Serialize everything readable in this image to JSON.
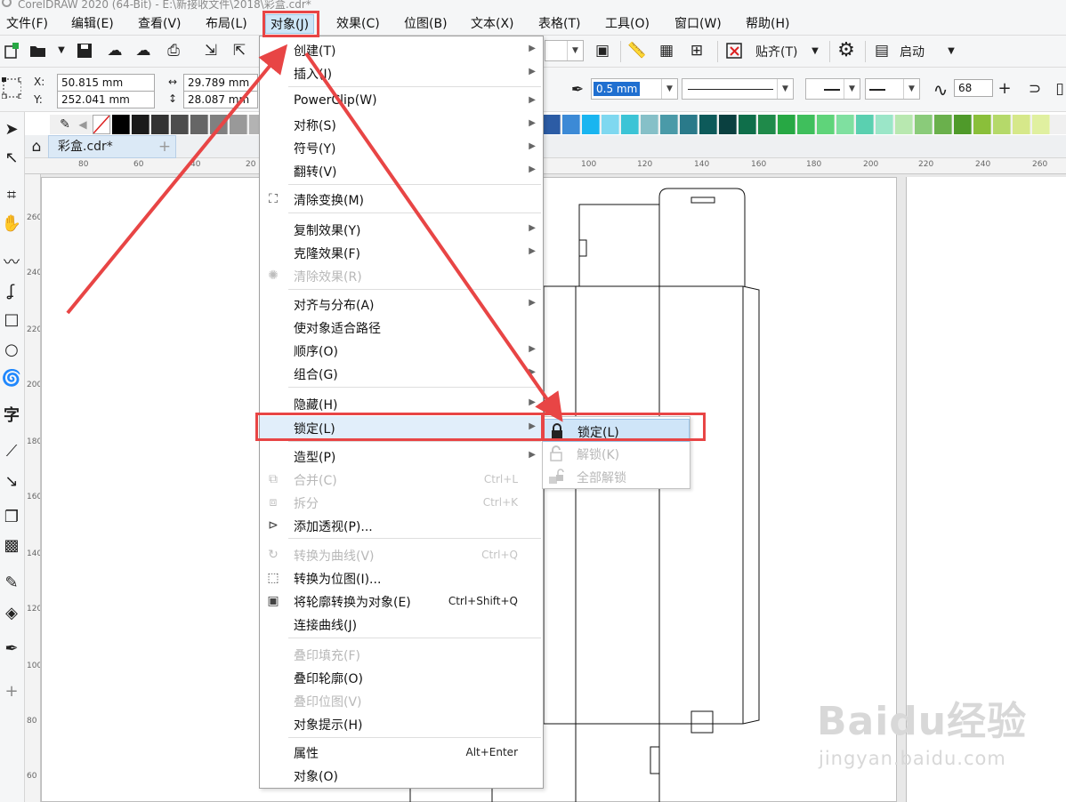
{
  "window": {
    "title": "CorelDRAW 2020 (64-Bit) - E:\\新接收文件\\2018\\彩盒.cdr*"
  },
  "menubar": {
    "items": [
      "文件(F)",
      "编辑(E)",
      "查看(V)",
      "布局(L)",
      "对象(J)",
      "效果(C)",
      "位图(B)",
      "文本(X)",
      "表格(T)",
      "工具(O)",
      "窗口(W)",
      "帮助(H)"
    ]
  },
  "toolbar": {
    "snap_label": "贴齐(T)",
    "launch_label": "启动"
  },
  "property_bar": {
    "x_label": "X:",
    "x_value": "50.815 mm",
    "y_label": "Y:",
    "y_value": "252.041 mm",
    "w_value": "29.789 mm",
    "h_value": "28.087 mm",
    "outline_width": "0.5 mm",
    "smoothing_value": "68"
  },
  "document": {
    "tab_label": "彩盒.cdr*"
  },
  "rulers": {
    "horizontal_ticks": [
      "80",
      "60",
      "40",
      "20",
      "100",
      "120",
      "140",
      "160",
      "180",
      "200",
      "220",
      "240",
      "260"
    ],
    "vertical_ticks": [
      "260",
      "240",
      "220",
      "200",
      "180",
      "160",
      "140",
      "120",
      "100",
      "80",
      "60"
    ]
  },
  "object_menu": {
    "items": [
      {
        "label": "创建(T)",
        "submenu": true,
        "disabled": false
      },
      {
        "label": "插入(I)",
        "submenu": true,
        "disabled": false
      },
      {
        "label": "PowerClip(W)",
        "submenu": true,
        "disabled": false
      },
      {
        "label": "对称(S)",
        "submenu": true,
        "disabled": false
      },
      {
        "label": "符号(Y)",
        "submenu": true,
        "disabled": false
      },
      {
        "label": "翻转(V)",
        "submenu": true,
        "disabled": false
      },
      {
        "label": "清除变换(M)",
        "submenu": false,
        "disabled": false
      },
      {
        "label": "复制效果(Y)",
        "submenu": true,
        "disabled": false
      },
      {
        "label": "克隆效果(F)",
        "submenu": true,
        "disabled": false
      },
      {
        "label": "清除效果(R)",
        "submenu": false,
        "disabled": true
      },
      {
        "label": "对齐与分布(A)",
        "submenu": true,
        "disabled": false
      },
      {
        "label": "使对象适合路径",
        "submenu": false,
        "disabled": false
      },
      {
        "label": "顺序(O)",
        "submenu": true,
        "disabled": false
      },
      {
        "label": "组合(G)",
        "submenu": true,
        "disabled": false
      },
      {
        "label": "隐藏(H)",
        "submenu": true,
        "disabled": false
      },
      {
        "label": "锁定(L)",
        "submenu": true,
        "disabled": false
      },
      {
        "label": "造型(P)",
        "submenu": true,
        "disabled": false
      },
      {
        "label": "合并(C)",
        "shortcut": "Ctrl+L",
        "disabled": true
      },
      {
        "label": "拆分",
        "shortcut": "Ctrl+K",
        "disabled": true
      },
      {
        "label": "添加透视(P)...",
        "disabled": false
      },
      {
        "label": "转换为曲线(V)",
        "shortcut": "Ctrl+Q",
        "disabled": true
      },
      {
        "label": "转换为位图(I)...",
        "disabled": false
      },
      {
        "label": "将轮廓转换为对象(E)",
        "shortcut": "Ctrl+Shift+Q",
        "disabled": false
      },
      {
        "label": "连接曲线(J)",
        "disabled": false
      },
      {
        "label": "叠印填充(F)",
        "disabled": true
      },
      {
        "label": "叠印轮廓(O)",
        "disabled": false
      },
      {
        "label": "叠印位图(V)",
        "disabled": true
      },
      {
        "label": "对象提示(H)",
        "disabled": false
      },
      {
        "label": "属性",
        "shortcut": "Alt+Enter",
        "disabled": false
      },
      {
        "label": "对象(O)",
        "disabled": false
      }
    ]
  },
  "lock_submenu": {
    "items": [
      {
        "label": "锁定(L)",
        "disabled": false
      },
      {
        "label": "解锁(K)",
        "disabled": true
      },
      {
        "label": "全部解锁",
        "disabled": true
      }
    ]
  },
  "watermark": {
    "brand": "Baidu经验",
    "url": "jingyan.baidu.com"
  },
  "colors": {
    "highlight_red": "#e84545",
    "menu_hover": "#e1eefa"
  }
}
